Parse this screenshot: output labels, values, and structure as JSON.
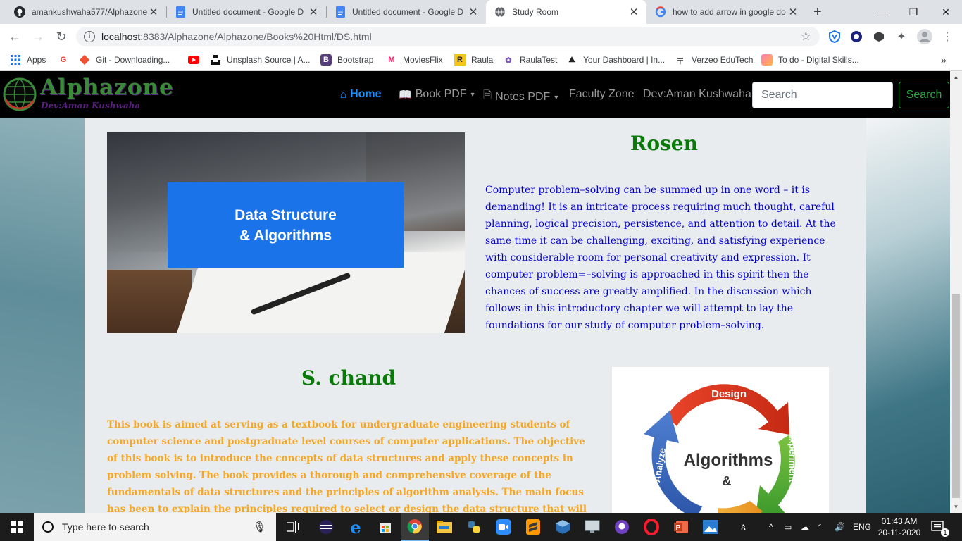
{
  "browser": {
    "tabs": [
      {
        "title": "amankushwaha577/Alphazone",
        "icon": "github-icon"
      },
      {
        "title": "Untitled document - Google D",
        "icon": "google-docs-icon"
      },
      {
        "title": "Untitled document - Google D",
        "icon": "google-docs-icon"
      },
      {
        "title": "Study Room",
        "icon": "globe-icon"
      },
      {
        "title": "how to add arrow in google do",
        "icon": "google-icon"
      }
    ],
    "url_host": "localhost",
    "url_rest": ":8383/Alphazone/Alphazone/Books%20Html/DS.html",
    "bookmarks": [
      {
        "label": "Apps"
      },
      {
        "label": ""
      },
      {
        "label": "Git - Downloading..."
      },
      {
        "label": ""
      },
      {
        "label": "Unsplash Source | A..."
      },
      {
        "label": "Bootstrap"
      },
      {
        "label": "MoviesFlix"
      },
      {
        "label": "Raula"
      },
      {
        "label": "RaulaTest"
      },
      {
        "label": "Your Dashboard | In..."
      },
      {
        "label": "Verzeo EduTech"
      },
      {
        "label": "To do - Digital Skills..."
      }
    ]
  },
  "site": {
    "logo": "Alphazone",
    "logo_sub": "Dev:Aman Kushwaha",
    "nav": {
      "home": "Home",
      "book_pdf": "Book PDF",
      "notes_pdf": "Notes PDF",
      "faculty": "Faculty Zone",
      "dev": "Dev:Aman Kushwaha"
    },
    "search_placeholder": "Search",
    "search_button": "Search"
  },
  "books": [
    {
      "title": "Rosen",
      "banner_line1": "Data Structure",
      "banner_line2": "& Algorithms",
      "description": "Computer problem–solving can be summed up in one word – it is demanding! It is an intricate process requiring much thought, careful planning, logical precision, persistence, and attention to detail. At the same time it can be challenging, exciting, and satisfying experience with considerable room for personal creativity and expression. It computer problem=–solving is approached in this spirit then the chances of success are greatly amplified. In the discussion which follows in this introductory chapter we will attempt to lay the foundations for our study of computer problem–solving.",
      "color": "#0000cc"
    },
    {
      "title": "S. chand",
      "description": "This book is aimed at serving as a textbook for undergraduate engineering students of computer science and postgraduate level courses of computer applications. The objective of this book is to introduce the concepts of data structures and apply these concepts in problem solving. The book provides a thorough and comprehensive coverage of the fundamentals of data structures and the principles of algorithm analysis. The main focus has been to explain the principles required to select or design the data structure that will best solve the problem.",
      "color": "#f5a623",
      "diagram": {
        "design": "Design",
        "experiment": "Experiment",
        "analyze": "Analyze",
        "center1": "Algorithms",
        "center2": "&"
      }
    }
  ],
  "taskbar": {
    "search_placeholder": "Type here to search",
    "lang": "ENG",
    "time": "01:43 AM",
    "date": "20-11-2020",
    "notifications": "1"
  }
}
